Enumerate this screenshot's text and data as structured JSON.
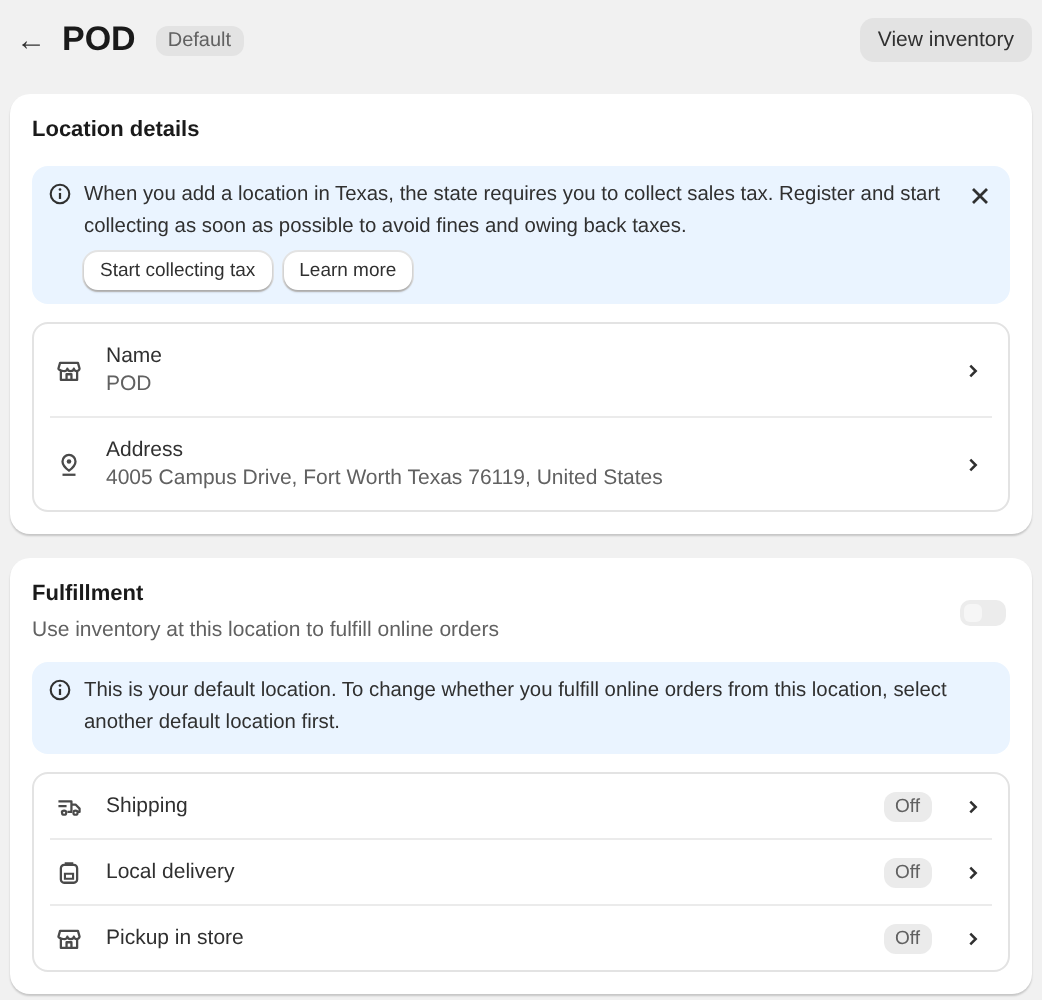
{
  "header": {
    "back": "←",
    "title": "POD",
    "badge": "Default",
    "action": "View inventory"
  },
  "location_details": {
    "title": "Location details",
    "banner": {
      "text": "When you add a location in Texas, the state requires you to collect sales tax. Register and start collecting as soon as possible to avoid fines and owing back taxes.",
      "buttons": [
        "Start collecting tax",
        "Learn more"
      ]
    },
    "rows": [
      {
        "kind": "store",
        "label": "Name",
        "value": "POD"
      },
      {
        "kind": "pin",
        "label": "Address",
        "value": "4005 Campus Drive, Fort Worth Texas 76119, United States"
      }
    ]
  },
  "fulfillment": {
    "title": "Fulfillment",
    "description": "Use inventory at this location to fulfill online orders",
    "toggle": {
      "on": false,
      "disabled": true
    },
    "banner": {
      "text": "This is your default location. To change whether you fulfill online orders from this location, select another default location first."
    },
    "rows": [
      {
        "kind": "truck",
        "label": "Shipping",
        "status": "Off"
      },
      {
        "kind": "bag",
        "label": "Local delivery",
        "status": "Off"
      },
      {
        "kind": "store",
        "label": "Pickup in store",
        "status": "Off"
      }
    ]
  }
}
